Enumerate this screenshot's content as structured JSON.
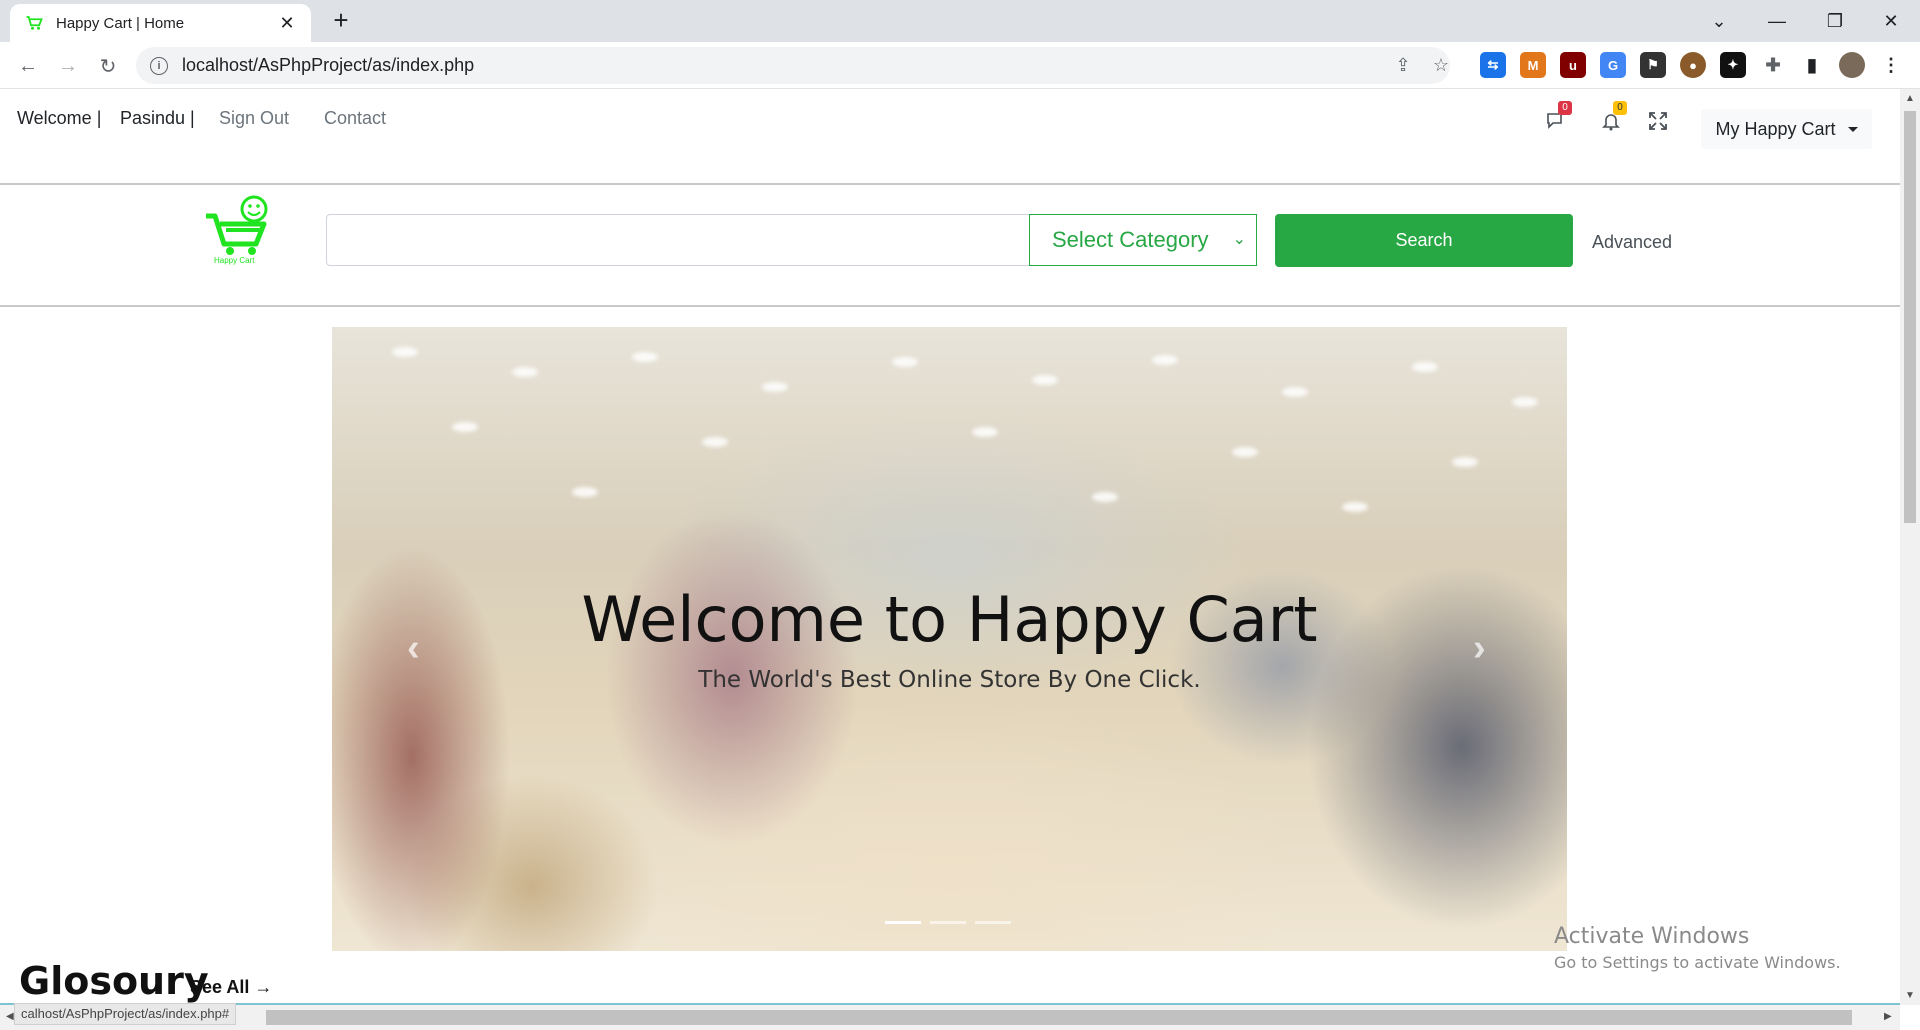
{
  "browser": {
    "tab_title": "Happy Cart | Home",
    "url": "localhost/AsPhpProject/as/index.php",
    "status_url": "calhost/AsPhpProject/as/index.php#"
  },
  "header": {
    "welcome": "Welcome |",
    "username": "Pasindu |",
    "sign_out": "Sign Out",
    "contact": "Contact",
    "message_count": "0",
    "notification_count": "0",
    "my_cart": "My Happy Cart"
  },
  "search": {
    "placeholder": "",
    "category": "Select Category",
    "button": "Search",
    "advanced": "Advanced"
  },
  "logo_text": "Happy Cart",
  "carousel": {
    "title": "Welcome to Happy Cart",
    "subtitle": "The World's Best Online Store By One Click.",
    "slides": 3,
    "active_slide": 1
  },
  "section": {
    "title": "Glosoury",
    "see_all": "See All →"
  },
  "watermark": {
    "line1": "Activate Windows",
    "line2": "Go to Settings to activate Windows."
  },
  "colors": {
    "brand_green": "#28a745",
    "logo_green": "#1fe41f",
    "msg_badge": "#dc3545",
    "notif_badge": "#ffc107"
  }
}
